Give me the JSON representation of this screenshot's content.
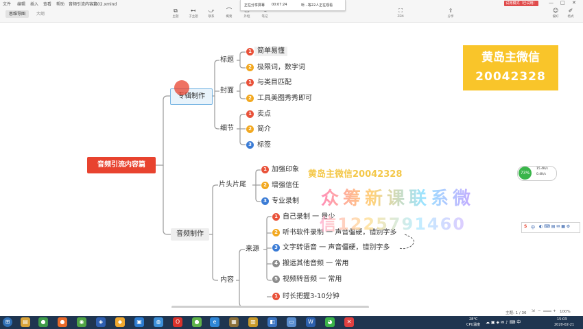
{
  "menu": [
    "文件",
    "编辑",
    "插入",
    "查看",
    "帮助"
  ],
  "file_name": "音频引流内容篇02.xmind",
  "tabs": [
    "思维导图",
    "大纲"
  ],
  "tools": [
    {
      "icon": "⧉",
      "label": "主题"
    },
    {
      "icon": "⊷",
      "label": "子主题"
    },
    {
      "icon": "⤻",
      "label": "联系"
    },
    {
      "icon": "⌒",
      "label": "概要"
    },
    {
      "icon": "▭",
      "label": "外框"
    },
    {
      "icon": "✎",
      "label": "笔记"
    }
  ],
  "tool_right": [
    {
      "icon": "⛶",
      "label": "ZEN"
    },
    {
      "icon": "⇧",
      "label": "分享"
    }
  ],
  "tool_far": [
    {
      "icon": "☺",
      "label": "偏好"
    },
    {
      "icon": "✐",
      "label": "格式"
    }
  ],
  "share_panel": {
    "status": "正在分享屏幕",
    "time": "00:07:24",
    "viewers": "听...等22人正在观看"
  },
  "red_button": "试用模式（已试用）",
  "mindmap": {
    "root": "音频引流内容篇",
    "branch1": "专辑制作",
    "b1": {
      "title": "标题",
      "title_items": [
        "简单易懂",
        "极限词，数字词"
      ],
      "cover": "封面",
      "cover_items": [
        "与类目匹配",
        "工具美图秀秀即可"
      ],
      "detail": "细节",
      "detail_items": [
        "卖点",
        "简介",
        "标签"
      ]
    },
    "branch2": "音频制作",
    "b2": {
      "intro": "片头片尾",
      "intro_items": [
        "加强印象",
        "增强信任",
        "专业录制"
      ],
      "content": "内容",
      "source": "来源",
      "source_items": [
        "自己录制 一 量少",
        "听书软件录制 一 声音僵硬，错别字多",
        "文字转语音 一 声音僵硬，错别字多",
        "搬运其他音频 一  常用",
        "视频转音频 一 常用"
      ],
      "length_item": "时长把握3-10分钟"
    }
  },
  "watermark_box": {
    "line1": "黄岛主微信",
    "line2": "20042328"
  },
  "watermark_text1": "黄岛主微信20042328",
  "watermark_text2": "众筹新课联系微",
  "watermark_text3": "信1225791460",
  "net_widget": {
    "percent": "73%",
    "up": "15.4K/s",
    "down": "0.4K/s"
  },
  "ime": {
    "brand": "S",
    "label": "中"
  },
  "status": {
    "topic": "主题: 1 / 36",
    "zoom": "100%"
  },
  "tray": {
    "temp": "28°C",
    "weather": "CPU温度"
  },
  "clock": {
    "time": "15:03",
    "date": "2020-02-21"
  }
}
